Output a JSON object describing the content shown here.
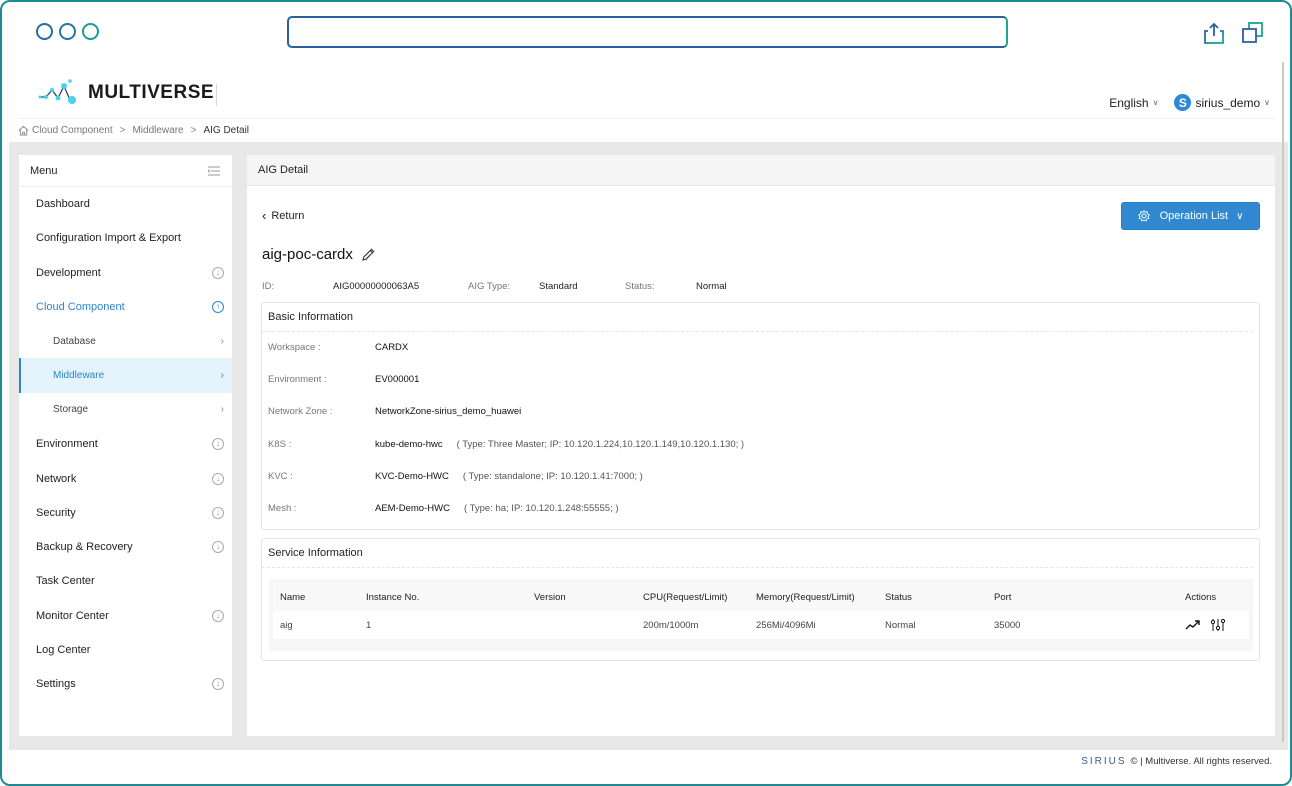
{
  "browser": {
    "url": "",
    "icons": [
      "share-icon",
      "tabs-icon"
    ]
  },
  "brand": {
    "name": "MULTIVERSE"
  },
  "header": {
    "language": "English",
    "user_initial": "S",
    "username": "sirius_demo"
  },
  "breadcrumb": [
    "Cloud Component",
    "Middleware",
    "AIG Detail"
  ],
  "sidebar": {
    "title": "Menu",
    "items": [
      {
        "label": "Dashboard",
        "icon": null
      },
      {
        "label": "Configuration Import & Export",
        "icon": null
      },
      {
        "label": "Development",
        "icon": "expand-down-icon"
      },
      {
        "label": "Cloud Component",
        "icon": "collapse-up-icon",
        "open": true
      },
      {
        "label": "Database",
        "icon": "chevron-right-icon",
        "sub": true
      },
      {
        "label": "Middleware",
        "icon": "chevron-right-icon",
        "sub": true,
        "active": true
      },
      {
        "label": "Storage",
        "icon": "chevron-right-icon",
        "sub": true
      },
      {
        "label": "Environment",
        "icon": "expand-down-icon"
      },
      {
        "label": "Network",
        "icon": "expand-down-icon"
      },
      {
        "label": "Security",
        "icon": "expand-down-icon"
      },
      {
        "label": "Backup & Recovery",
        "icon": "expand-down-icon"
      },
      {
        "label": "Task Center",
        "icon": null
      },
      {
        "label": "Monitor Center",
        "icon": "expand-down-icon"
      },
      {
        "label": "Log Center",
        "icon": null
      },
      {
        "label": "Settings",
        "icon": "expand-down-icon"
      }
    ]
  },
  "panel": {
    "title": "AIG Detail",
    "return_label": "Return",
    "operation_button": "Operation List",
    "aig_name": "aig-poc-cardx",
    "meta": {
      "id_label": "ID:",
      "id_value": "AIG00000000063A5",
      "type_label": "AIG Type:",
      "type_value": "Standard",
      "status_label": "Status:",
      "status_value": "Normal"
    }
  },
  "basic_info": {
    "title": "Basic Information",
    "rows": [
      {
        "label": "Workspace :",
        "value": "CARDX",
        "extra": ""
      },
      {
        "label": "Environment :",
        "value": "EV000001",
        "extra": ""
      },
      {
        "label": "Network Zone :",
        "value": "NetworkZone-sirius_demo_huawei",
        "extra": ""
      },
      {
        "label": "K8S :",
        "value": "kube-demo-hwc",
        "extra": "( Type: Three Master;  IP: 10.120.1.224,10.120.1.149,10.120.1.130; )"
      },
      {
        "label": "KVC :",
        "value": "KVC-Demo-HWC",
        "extra": "( Type: standalone;  IP: 10.120.1.41:7000; )"
      },
      {
        "label": "Mesh :",
        "value": "AEM-Demo-HWC",
        "extra": "( Type: ha;  IP: 10.120.1.248:55555; )"
      }
    ]
  },
  "service_info": {
    "title": "Service Information",
    "columns": [
      "Name",
      "Instance No.",
      "Version",
      "CPU(Request/Limit)",
      "Memory(Request/Limit)",
      "Status",
      "Port",
      "Actions"
    ],
    "rows": [
      {
        "name": "aig",
        "instance_no": "1",
        "version": "",
        "cpu": "200m/1000m",
        "memory": "256Mi/4096Mi",
        "status": "Normal",
        "port": "35000",
        "actions": [
          "trend-icon",
          "adjust-icon"
        ]
      }
    ]
  },
  "footer": {
    "logo_text": "SIRIUS",
    "copyright": "© | Multiverse. All rights reserved."
  },
  "colors": {
    "accent": "#2b86d1",
    "button": "#3089d0",
    "active_bg": "#e4f3fc",
    "window_border": "#1f8a92"
  }
}
